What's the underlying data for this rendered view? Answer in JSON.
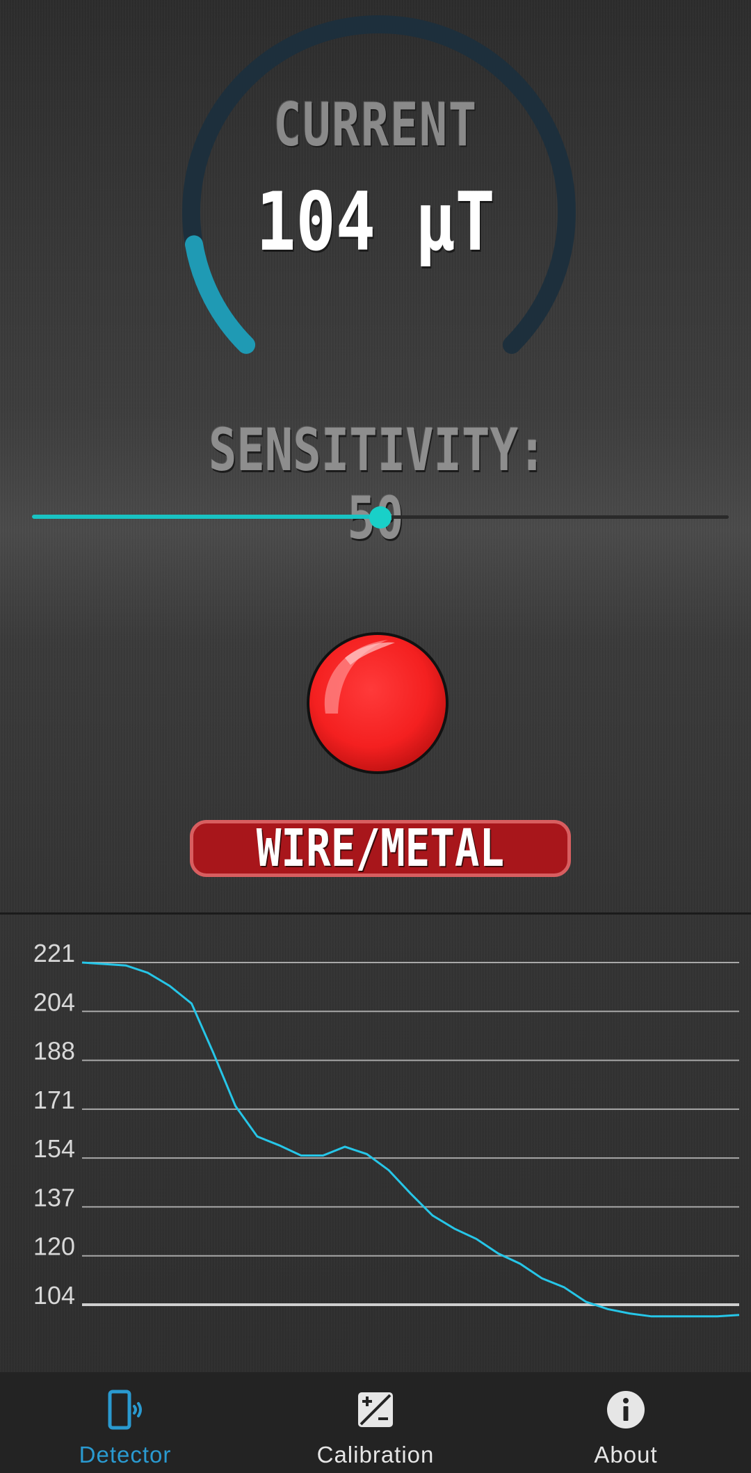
{
  "gauge": {
    "title": "CURRENT",
    "value": "104 μT",
    "fill_fraction": 0.13,
    "track_color": "#1d2f3c",
    "fill_color": "#1f9ab4"
  },
  "sensitivity": {
    "label": "SENSITIVITY: 50",
    "value": 50,
    "max": 100,
    "accent_color": "#19c3c3"
  },
  "indicator": {
    "state_color": "#ff2a2a",
    "icon": "red-led-icon"
  },
  "detection_badge": {
    "label": "WIRE/METAL",
    "color": "#a8161b"
  },
  "chart_data": {
    "type": "line",
    "y_ticks": [
      "221",
      "204",
      "188",
      "171",
      "154",
      "137",
      "120",
      "104"
    ],
    "ylim": [
      104,
      221
    ],
    "grid": true,
    "series": [
      {
        "color": "#26c6e8",
        "values": [
          221,
          220.5,
          220,
          217.5,
          213,
          207,
          190,
          172,
          161.5,
          158.5,
          155,
          155,
          158,
          155.5,
          150,
          142,
          134.5,
          130,
          126.5,
          121.5,
          118,
          113,
          110,
          105,
          102.5,
          101,
          100,
          100,
          100,
          100,
          100.5
        ]
      }
    ]
  },
  "bottom_nav": {
    "items": [
      {
        "label": "Detector",
        "icon": "phone-signal-icon",
        "active": true
      },
      {
        "label": "Calibration",
        "icon": "calibration-icon",
        "active": false
      },
      {
        "label": "About",
        "icon": "info-icon",
        "active": false
      }
    ],
    "active_color": "#2a9ad0"
  }
}
